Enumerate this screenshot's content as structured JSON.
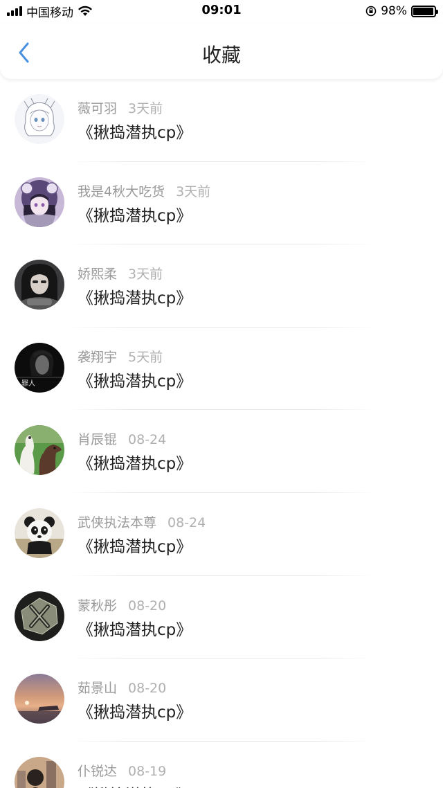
{
  "status_bar": {
    "carrier": "中国移动",
    "time": "09:01",
    "battery_text": "98%",
    "battery_level": 0.98
  },
  "nav": {
    "title": "收藏",
    "back_icon": "chevron-left-icon",
    "accent_color": "#4a90e2"
  },
  "items": [
    {
      "user": "薇可羽",
      "time": "3天前",
      "title": "《揪捣潜执cp》",
      "avatar": "anime-girl-white"
    },
    {
      "user": "我是4秋大吃货",
      "time": "3天前",
      "title": "《揪捣潜执cp》",
      "avatar": "anime-girl-purple"
    },
    {
      "user": "娇熙柔",
      "time": "3天前",
      "title": "《揪捣潜执cp》",
      "avatar": "girl-dark"
    },
    {
      "user": "袭翔宇",
      "time": "5天前",
      "title": "《揪捣潜执cp》",
      "avatar": "boy-bw",
      "avatar_text": "罪人"
    },
    {
      "user": "肖辰锟",
      "time": "08-24",
      "title": "《揪捣潜执cp》",
      "avatar": "alpacas"
    },
    {
      "user": "武侠执法本尊",
      "time": "08-24",
      "title": "《揪捣潜执cp》",
      "avatar": "panda"
    },
    {
      "user": "蒙秋彤",
      "time": "08-20",
      "title": "《揪捣潜执cp》",
      "avatar": "stone-logo"
    },
    {
      "user": "茹景山",
      "time": "08-20",
      "title": "《揪捣潜执cp》",
      "avatar": "sunset"
    },
    {
      "user": "仆锐达",
      "time": "08-19",
      "title": "《揪捣潜执cp》",
      "avatar": "city-person"
    }
  ]
}
